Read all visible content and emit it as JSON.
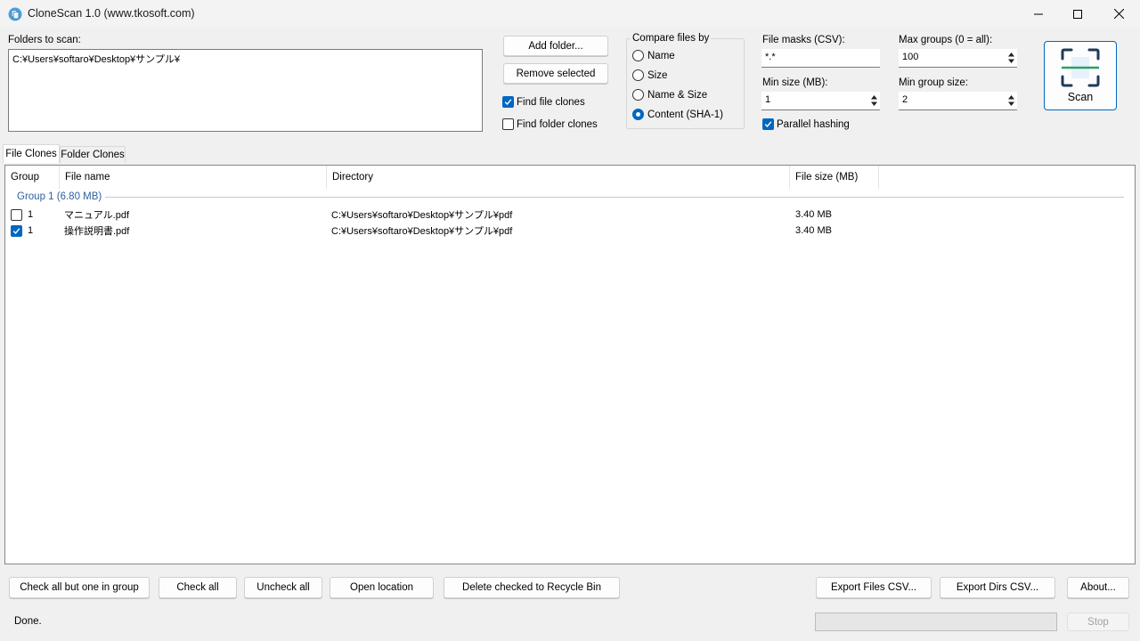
{
  "window": {
    "title": "CloneScan 1.0 (www.tkosoft.com)"
  },
  "folders": {
    "label": "Folders to scan:",
    "value": "C:¥Users¥softaro¥Desktop¥サンプル¥"
  },
  "folder_buttons": {
    "add": "Add folder...",
    "remove": "Remove selected"
  },
  "options": {
    "find_file_clones": {
      "label": "Find file clones",
      "checked": true
    },
    "find_folder_clones": {
      "label": "Find folder clones",
      "checked": false
    },
    "parallel_hashing": {
      "label": "Parallel hashing",
      "checked": true
    }
  },
  "compare": {
    "title": "Compare files by",
    "options": [
      {
        "label": "Name",
        "selected": false
      },
      {
        "label": "Size",
        "selected": false
      },
      {
        "label": "Name & Size",
        "selected": false
      },
      {
        "label": "Content (SHA-1)",
        "selected": true
      }
    ]
  },
  "filters": {
    "file_masks_label": "File masks (CSV):",
    "file_masks_value": "*.*",
    "min_size_label": "Min size (MB):",
    "min_size_value": "1",
    "max_groups_label": "Max groups (0 = all):",
    "max_groups_value": "100",
    "min_group_size_label": "Min group size:",
    "min_group_size_value": "2"
  },
  "scan_button": {
    "label": "Scan"
  },
  "tabs": [
    {
      "label": "File Clones",
      "active": true
    },
    {
      "label": "Folder Clones",
      "active": false
    }
  ],
  "table": {
    "columns": [
      "Group",
      "File name",
      "Directory",
      "File size (MB)"
    ],
    "groups": [
      {
        "title": "Group 1 (6.80 MB)",
        "rows": [
          {
            "checked": false,
            "group": "1",
            "file_name": "マニュアル.pdf",
            "directory": "C:¥Users¥softaro¥Desktop¥サンプル¥pdf",
            "size": "3.40 MB"
          },
          {
            "checked": true,
            "group": "1",
            "file_name": "操作説明書.pdf",
            "directory": "C:¥Users¥softaro¥Desktop¥サンプル¥pdf",
            "size": "3.40 MB"
          }
        ]
      }
    ]
  },
  "actions": {
    "check_all_but_one": "Check all but one in group",
    "check_all": "Check all",
    "uncheck_all": "Uncheck all",
    "open_location": "Open location",
    "delete_checked": "Delete checked to Recycle Bin",
    "export_files": "Export Files CSV...",
    "export_dirs": "Export Dirs CSV...",
    "about": "About..."
  },
  "status": {
    "text": "Done.",
    "progress": 0,
    "stop_label": "Stop"
  },
  "colors": {
    "accent": "#0067c0",
    "group_title": "#2f5f9e"
  }
}
